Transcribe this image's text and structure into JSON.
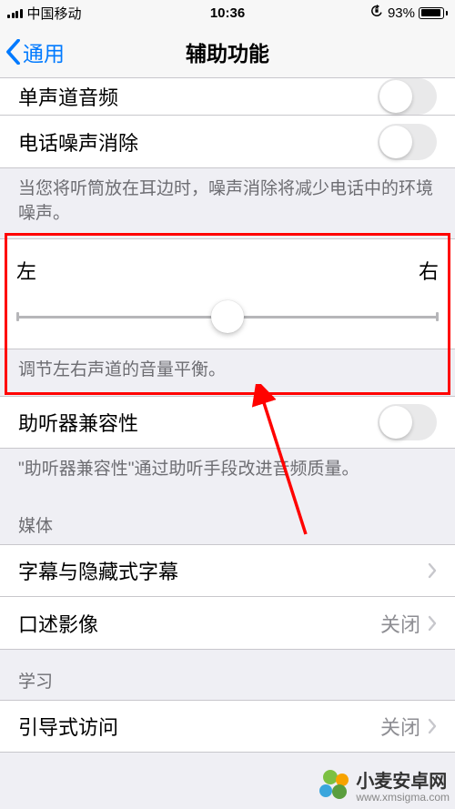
{
  "status": {
    "carrier": "中国移动",
    "time": "10:36",
    "battery_pct": "93%"
  },
  "nav": {
    "back_label": "通用",
    "title": "辅助功能"
  },
  "rows": {
    "mono_audio": "单声道音频",
    "phone_noise_cancel": "电话噪声消除",
    "noise_cancel_footer": "当您将听筒放在耳边时，噪声消除将减少电话中的环境噪声。",
    "balance_left": "左",
    "balance_right": "右",
    "balance_footer": "调节左右声道的音量平衡。",
    "hearing_aid_compat": "助听器兼容性",
    "hearing_aid_footer": "\"助听器兼容性\"通过助听手段改进音频质量。",
    "media_header": "媒体",
    "subtitles": "字幕与隐藏式字幕",
    "audio_descriptions": "口述影像",
    "audio_descriptions_value": "关闭",
    "learning_header": "学习",
    "guided_access": "引导式访问",
    "guided_access_value": "关闭"
  },
  "watermark": {
    "title": "小麦安卓网",
    "url": "www.xmsigma.com"
  }
}
